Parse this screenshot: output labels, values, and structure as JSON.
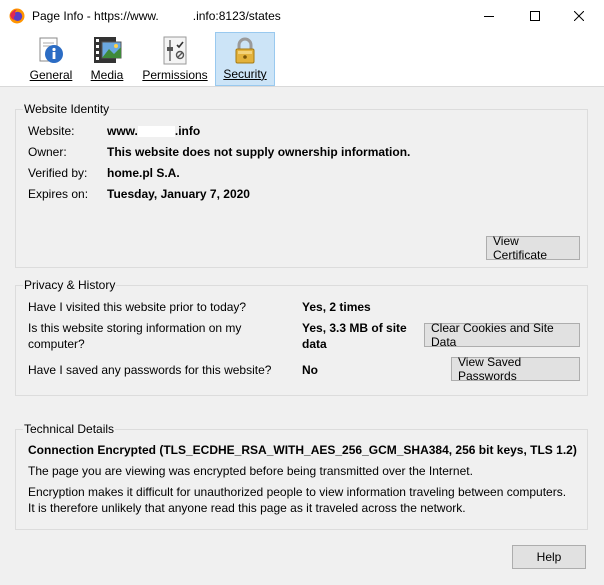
{
  "window": {
    "title_prefix": "Page Info - https://www.",
    "title_suffix": ".info:8123/states"
  },
  "tabs": [
    {
      "label": "General",
      "icon": "info-icon"
    },
    {
      "label": "Media",
      "icon": "media-icon"
    },
    {
      "label": "Permissions",
      "icon": "permissions-icon"
    },
    {
      "label": "Security",
      "icon": "lock-icon",
      "selected": true
    }
  ],
  "identity": {
    "title": "Website Identity",
    "website_label": "Website:",
    "website_prefix": "www.",
    "website_suffix": ".info",
    "owner_label": "Owner:",
    "owner_value": "This website does not supply ownership information.",
    "verified_label": "Verified by:",
    "verified_value": "home.pl S.A.",
    "expires_label": "Expires on:",
    "expires_value": "Tuesday, January 7, 2020",
    "view_certificate": "View Certificate"
  },
  "privacy": {
    "title": "Privacy & History",
    "visited_q": "Have I visited this website prior to today?",
    "visited_a": "Yes, 2 times",
    "storing_q_line1": "Is this website storing information on my",
    "storing_q_line2": "computer?",
    "storing_a_line1": "Yes, 3.3 MB of site",
    "storing_a_line2": "data",
    "clear_cookies": "Clear Cookies and Site Data",
    "passwords_q": "Have I saved any passwords for this website?",
    "passwords_a": "No",
    "view_passwords": "View Saved Passwords"
  },
  "technical": {
    "title": "Technical Details",
    "connection": "Connection Encrypted (TLS_ECDHE_RSA_WITH_AES_256_GCM_SHA384, 256 bit keys, TLS 1.2)",
    "para1": "The page you are viewing was encrypted before being transmitted over the Internet.",
    "para2_line1": "Encryption makes it difficult for unauthorized people to view information traveling between computers.",
    "para2_line2": "It is therefore unlikely that anyone read this page as it traveled across the network."
  },
  "help_button": "Help",
  "colors": {
    "selected_tab_bg": "#cce4f7",
    "selected_tab_border": "#99c9ef",
    "dialog_bg": "#f0f0f0"
  }
}
